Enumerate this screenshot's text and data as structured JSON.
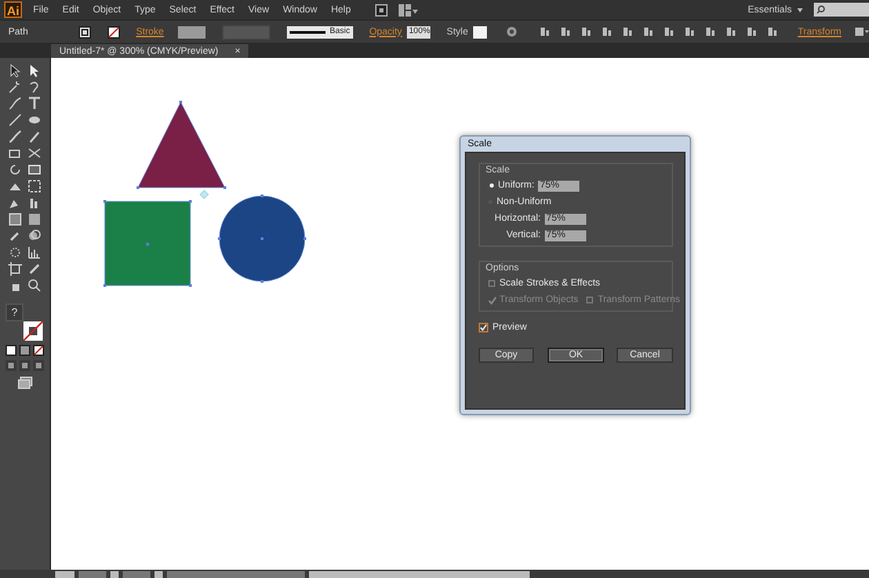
{
  "menu_bar": {
    "logo": "Ai",
    "items": [
      "File",
      "Edit",
      "Object",
      "Type",
      "Select",
      "Effect",
      "View",
      "Window",
      "Help"
    ],
    "workspace": "Essentials"
  },
  "control_bar": {
    "selection": "Path",
    "stroke_label": "Stroke",
    "brush": "Basic",
    "opacity_label": "Opacity",
    "opacity": "100%",
    "style_label": "Style",
    "transform_link": "Transform"
  },
  "document_tab": {
    "title": "Untitled-7* @ 300% (CMYK/Preview)",
    "close": "×"
  },
  "toolbox": {
    "fill_hint": "?"
  },
  "artwork": [
    {
      "kind": "triangle",
      "color": "#7a1f45"
    },
    {
      "kind": "square",
      "color": "#1b8048"
    },
    {
      "kind": "circle",
      "color": "#1c4585"
    }
  ],
  "dialog": {
    "title": "Scale",
    "scale_group": "Scale",
    "modes": [
      {
        "label": "Uniform:",
        "selected": true,
        "value": "75%"
      },
      {
        "label": "Non-Uniform",
        "selected": false
      }
    ],
    "fields": [
      {
        "label": "Horizontal:",
        "value": "75%"
      },
      {
        "label": "Vertical:",
        "value": "75%"
      }
    ],
    "options_group": "Options",
    "checkboxes": [
      {
        "label": "Scale Strokes & Effects",
        "checked": false,
        "disabled": false
      },
      {
        "label": "Transform Objects",
        "checked": true,
        "disabled": true
      },
      {
        "label": "Transform Patterns",
        "checked": false,
        "disabled": true
      }
    ],
    "preview": {
      "label": "Preview",
      "checked": true
    },
    "buttons": [
      {
        "label": "Copy",
        "default": false
      },
      {
        "label": "OK",
        "default": true
      },
      {
        "label": "Cancel",
        "default": false
      }
    ]
  }
}
